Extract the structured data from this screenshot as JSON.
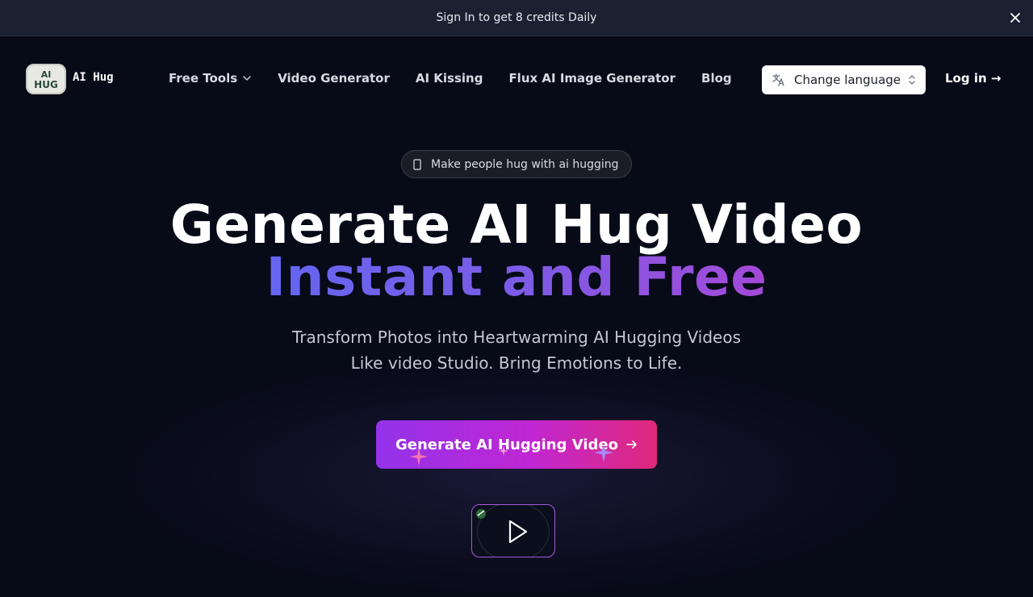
{
  "banner": {
    "text": "Sign In to get 8 credits Daily",
    "close_icon": "close-icon"
  },
  "brand": {
    "logo_text": "AI HUG",
    "name": "AI Hug"
  },
  "nav": {
    "items": [
      {
        "label": "Free Tools",
        "has_dropdown": true
      },
      {
        "label": "Video Generator"
      },
      {
        "label": "AI Kissing"
      },
      {
        "label": "Flux AI Image Generator"
      },
      {
        "label": "Blog"
      }
    ],
    "language_button": "Change language",
    "login": "Log in →"
  },
  "hero": {
    "pill": "Make people hug with ai hugging",
    "title_line1": "Generate AI Hug Video",
    "title_line2": "Instant and Free",
    "subtitle": "Transform Photos into Heartwarming AI Hugging Videos Like video Studio. Bring Emotions to Life.",
    "cta_label": "Generate AI Hugging Video"
  },
  "colors": {
    "background": "#070a17",
    "banner": "#1b2131",
    "accent_gradient_start": "#6466f1",
    "accent_gradient_end": "#a449d8",
    "cta_gradient_start": "#9333ea",
    "cta_gradient_end": "#e0297a"
  }
}
